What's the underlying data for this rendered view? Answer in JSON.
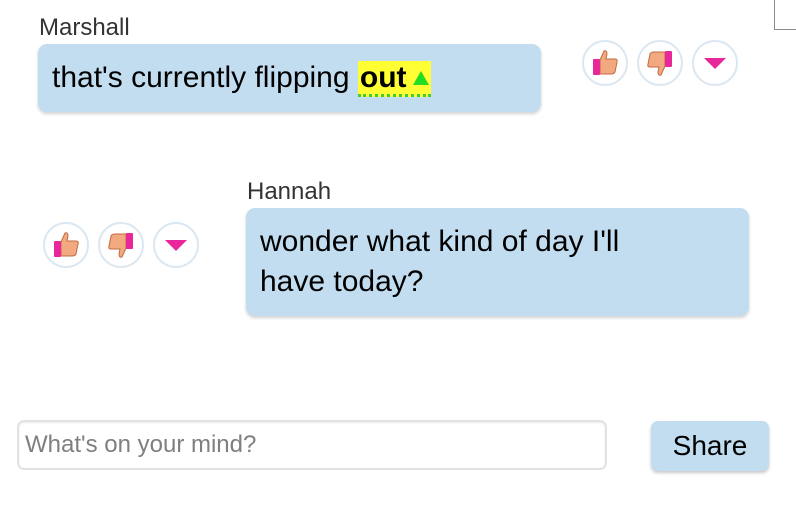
{
  "messages": [
    {
      "sender": "Marshall",
      "text_before": "that's currently flipping ",
      "highlight": "out"
    },
    {
      "sender": "Hannah",
      "line1": "wonder what kind of day I'll",
      "line2": "have today?"
    }
  ],
  "reactions": {
    "thumbs_up": "thumbs-up-icon",
    "thumbs_down": "thumbs-down-icon",
    "more": "chevron-down-icon"
  },
  "composer": {
    "placeholder": "What's on your mind?",
    "value": "",
    "share_label": "Share"
  },
  "colors": {
    "bubble": "#c2ddf0",
    "highlight": "#ffff33",
    "highlight_marker": "#22dd22",
    "reaction_accent": "#e8279b",
    "thumb_skin": "#f3a97f"
  }
}
